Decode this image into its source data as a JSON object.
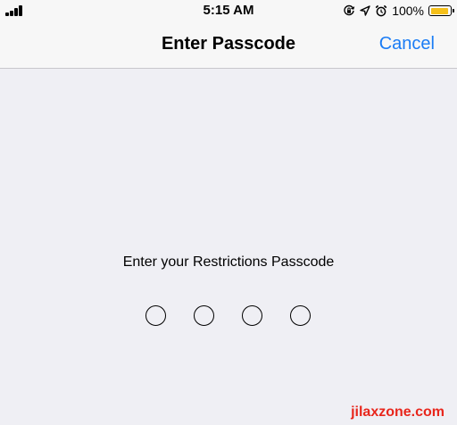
{
  "status_bar": {
    "time": "5:15 AM",
    "battery_percent": "100%",
    "battery_level": 1.0,
    "battery_color": "#f5c01a",
    "icons": [
      "signal-bars-icon",
      "orientation-lock-icon",
      "location-arrow-icon",
      "alarm-icon",
      "battery-icon"
    ]
  },
  "nav": {
    "title": "Enter Passcode",
    "cancel_label": "Cancel",
    "accent": "#1a7cf5"
  },
  "main": {
    "prompt": "Enter your Restrictions Passcode",
    "passcode_length": 4,
    "digits_entered": 0
  },
  "watermark": {
    "text": "jilaxzone.com",
    "color": "#e8261c"
  }
}
